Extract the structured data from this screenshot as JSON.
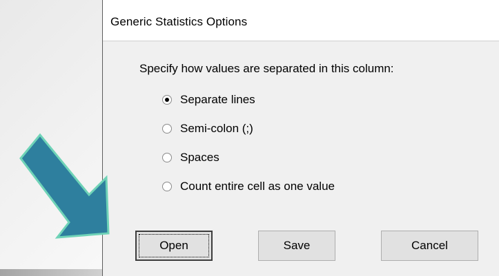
{
  "dialog": {
    "title": "Generic Statistics Options",
    "instruction": "Specify how values are separated in this column:",
    "options": [
      {
        "label": "Separate lines",
        "checked": true
      },
      {
        "label": "Semi-colon (;)",
        "checked": false
      },
      {
        "label": "Spaces",
        "checked": false
      },
      {
        "label": "Count entire cell as one value",
        "checked": false
      }
    ],
    "buttons": {
      "open": "Open",
      "save": "Save",
      "cancel": "Cancel"
    }
  },
  "annotation": {
    "arrow_color": "#2e7f9e",
    "arrow_outline": "#6fd3b7"
  }
}
